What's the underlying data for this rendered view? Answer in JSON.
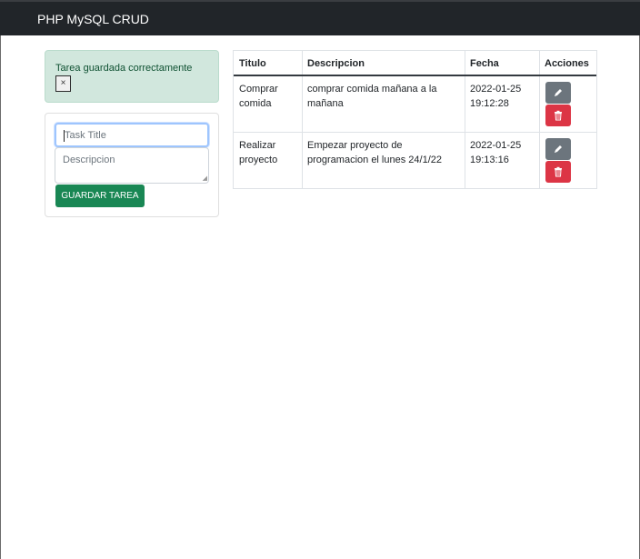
{
  "navbar": {
    "brand": "PHP MySQL CRUD"
  },
  "alert": {
    "message": "Tarea guardada correctamente",
    "close_label": "×"
  },
  "form": {
    "title_placeholder": "Task Title",
    "description_placeholder": "Descripcion",
    "save_label": "GUARDAR TAREA"
  },
  "table": {
    "headers": [
      "Titulo",
      "Descripcion",
      "Fecha",
      "Acciones"
    ],
    "rows": [
      {
        "title_line1": "Comprar",
        "title_line2": "comida",
        "desc_line1": "comprar comida mañana a la",
        "desc_line2": "mañana",
        "date_line1": "2022-01-25",
        "date_line2": "19:12:28"
      },
      {
        "title_line1": "Realizar",
        "title_line2": "proyecto",
        "desc_line1": "Empezar proyecto de",
        "desc_line2": "programacion el lunes 24/1/22",
        "date_line1": "2022-01-25",
        "date_line2": "19:13:16"
      }
    ]
  },
  "icons": {
    "edit": "pencil-icon",
    "delete": "trash-icon"
  },
  "colors": {
    "navbar": "#212529",
    "success": "#198754",
    "secondary": "#6c757d",
    "danger": "#dc3545",
    "alert_bg": "#d1e7dd"
  }
}
